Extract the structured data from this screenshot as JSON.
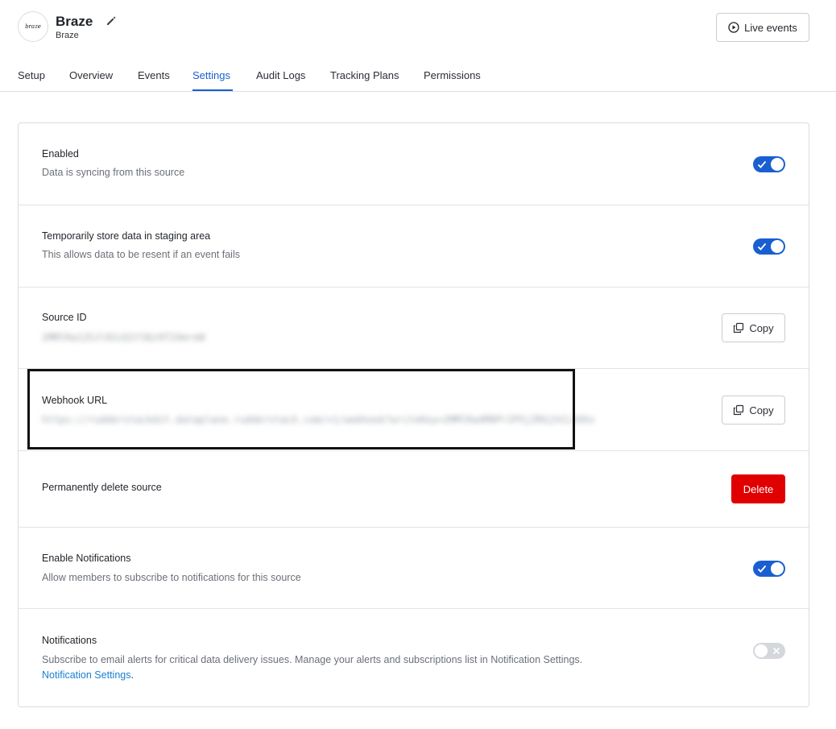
{
  "header": {
    "logo_text": "braze",
    "title": "Braze",
    "subtitle": "Braze",
    "live_events_label": "Live events"
  },
  "tabs": [
    {
      "label": "Setup"
    },
    {
      "label": "Overview"
    },
    {
      "label": "Events"
    },
    {
      "label": "Settings",
      "active": true
    },
    {
      "label": "Audit Logs"
    },
    {
      "label": "Tracking Plans"
    },
    {
      "label": "Permissions"
    }
  ],
  "settings": {
    "enabled": {
      "label": "Enabled",
      "description": "Data is syncing from this source",
      "toggle": "on"
    },
    "staging": {
      "label": "Temporarily store data in staging area",
      "description": "This allows data to be resent if an event fails",
      "toggle": "on"
    },
    "source_id": {
      "label": "Source ID",
      "value": "2MMlRa1ZSJl02zQ1Y3Qz9TZ4mreW",
      "copy_label": "Copy"
    },
    "webhook_url": {
      "label": "Webhook URL",
      "value": "https://rudderstackdzt.dataplane.rudderstack.com/v1/webhook?writeKey=2MMlRa4M8Pr2P5jZRGjhCLSHXx",
      "copy_label": "Copy"
    },
    "delete": {
      "label": "Permanently delete source",
      "button_label": "Delete"
    },
    "enable_notifications": {
      "label": "Enable Notifications",
      "description": "Allow members to subscribe to notifications for this source",
      "toggle": "on"
    },
    "notifications": {
      "label": "Notifications",
      "description": "Subscribe to email alerts for critical data delivery issues. Manage your alerts and subscriptions list in Notification Settings.",
      "link_text": "Notification Settings",
      "link_suffix": ".",
      "toggle": "off"
    }
  },
  "icons": {
    "edit": "pencil-icon",
    "live": "play-circle-icon",
    "copy": "copy-icon",
    "toggle_on": "check-icon",
    "toggle_off": "x-icon"
  },
  "colors": {
    "accent": "#1a5fd1",
    "danger": "#e00000",
    "link": "#1a7fd1"
  }
}
